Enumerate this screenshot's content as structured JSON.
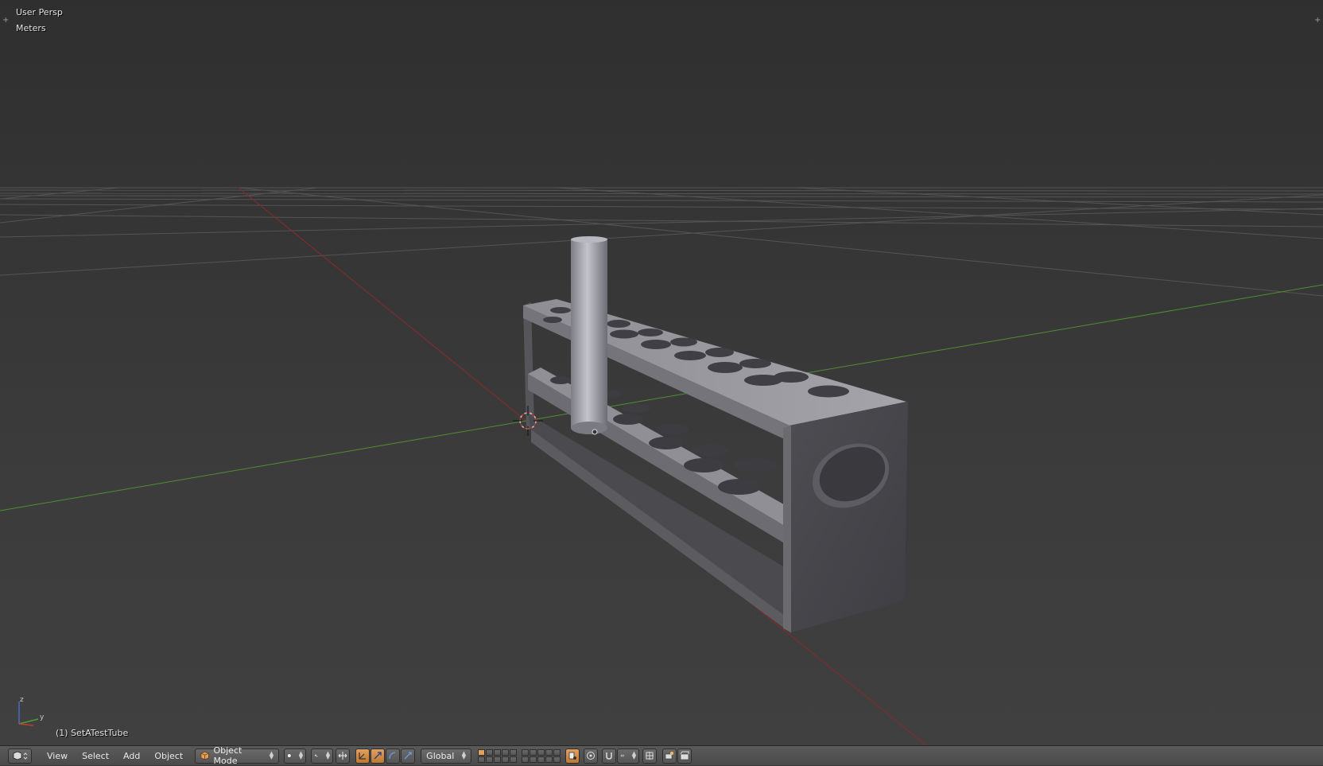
{
  "viewport": {
    "view_name": "User Persp",
    "units": "Meters",
    "active_object_label": "(1) SetATestTube",
    "axis_gizmo": {
      "z_label": "z",
      "y_label": "y"
    },
    "colors": {
      "x_axis": "#8a2a2a",
      "y_axis": "#4f8f2f",
      "grid": "#5a5a5a",
      "mesh": "#8e8e94"
    }
  },
  "header": {
    "editor_type_icon": "3d-view-icon",
    "menus": [
      "View",
      "Select",
      "Add",
      "Object"
    ],
    "mode": {
      "label": "Object Mode",
      "icon": "cube-icon"
    },
    "viewport_shading_icon": "solid-sphere-icon",
    "pivot_icon": "pivot-point-icon",
    "manipulator_icons": [
      "manipulator-toggle-icon",
      "translate-arrow-icon",
      "rotate-arc-icon",
      "scale-arrow-icon"
    ],
    "transform_orientation": "Global",
    "accent_color": "#e8a050"
  }
}
